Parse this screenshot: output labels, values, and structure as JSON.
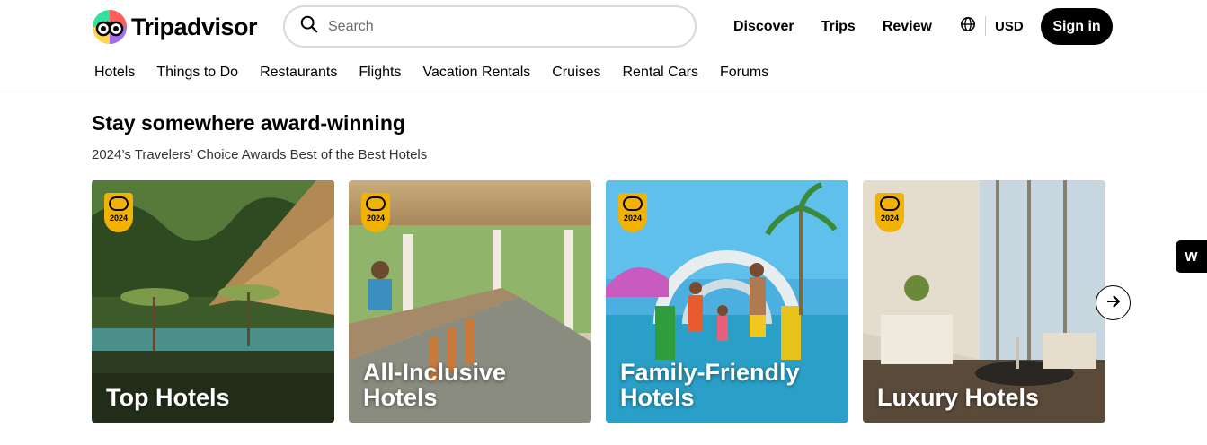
{
  "header": {
    "logo_text": "Tripadvisor",
    "search_placeholder": "Search",
    "nav": [
      "Discover",
      "Trips",
      "Review"
    ],
    "currency": "USD",
    "signin_label": "Sign in"
  },
  "subnav": [
    "Hotels",
    "Things to Do",
    "Restaurants",
    "Flights",
    "Vacation Rentals",
    "Cruises",
    "Rental Cars",
    "Forums"
  ],
  "section": {
    "title": "Stay somewhere award-winning",
    "subtitle": "2024’s Travelers’ Choice Awards Best of the Best Hotels"
  },
  "cards": [
    {
      "label_line1": "Top Hotels",
      "label_line2": "",
      "badge_year": "2024"
    },
    {
      "label_line1": "All-Inclusive",
      "label_line2": "Hotels",
      "badge_year": "2024"
    },
    {
      "label_line1": "Family-Friendly",
      "label_line2": "Hotels",
      "badge_year": "2024"
    },
    {
      "label_line1": "Luxury Hotels",
      "label_line2": "",
      "badge_year": "2024"
    }
  ],
  "side_tab_label": "W",
  "colors": {
    "brand_black": "#000000",
    "badge_yellow": "#f2b203",
    "border_gray": "#d9d9d9"
  }
}
